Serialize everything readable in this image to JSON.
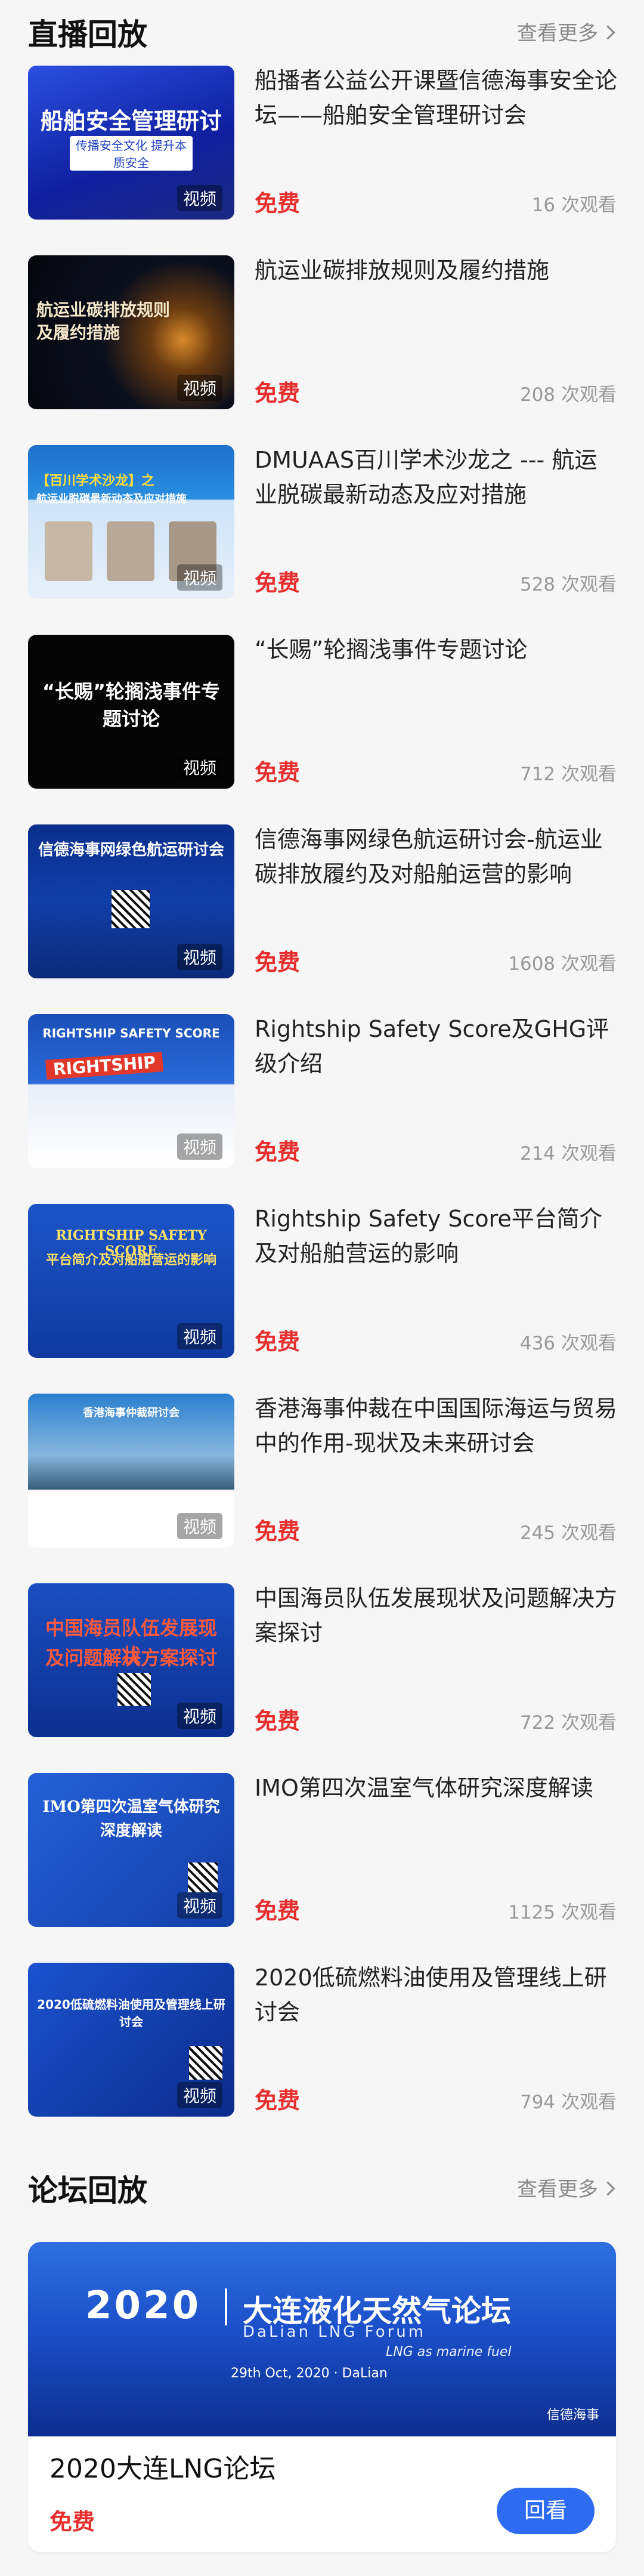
{
  "live_section": {
    "title": "直播回放",
    "more": "查看更多"
  },
  "items": [
    {
      "title": "船播者公益公开课暨信德海事安全论坛——船舶安全管理研讨会",
      "price": "免费",
      "views": "16 次观看",
      "tag": "视频",
      "thumb_lines": [
        "船舶安全管理研讨会",
        "传播安全文化 提升本质安全"
      ]
    },
    {
      "title": "航运业碳排放规则及履约措施",
      "price": "免费",
      "views": "208 次观看",
      "tag": "视频",
      "thumb_lines": [
        "航运业碳排放规则",
        "及履约措施"
      ]
    },
    {
      "title": "DMUAAS百川学术沙龙之 --- 航运业脱碳最新动态及应对措施",
      "price": "免费",
      "views": "528 次观看",
      "tag": "视频",
      "thumb_lines": [
        "【百川学术沙龙】之",
        "航运业脱碳最新动态及应对措施"
      ]
    },
    {
      "title": "“长赐”轮搁浅事件专题讨论",
      "price": "免费",
      "views": "712 次观看",
      "tag": "视频",
      "thumb_lines": [
        "“长赐”轮搁浅事件专题讨论"
      ]
    },
    {
      "title": "信德海事网绿色航运研讨会-航运业碳排放履约及对船舶运营的影响",
      "price": "免费",
      "views": "1608 次观看",
      "tag": "视频",
      "thumb_lines": [
        "信德海事网绿色航运研讨会"
      ]
    },
    {
      "title": "Rightship Safety Score及GHG评级介绍",
      "price": "免费",
      "views": "214 次观看",
      "tag": "视频",
      "thumb_lines": [
        "RIGHTSHIP SAFETY SCORE",
        "RIGHTSHIP"
      ]
    },
    {
      "title": "Rightship Safety Score平台简介及对船舶营运的影响",
      "price": "免费",
      "views": "436 次观看",
      "tag": "视频",
      "thumb_lines": [
        "RIGHTSHIP SAFETY SCORE",
        "平台简介及对船舶营运的影响"
      ]
    },
    {
      "title": "香港海事仲裁在中国国际海运与贸易中的作用-现状及未来研讨会",
      "price": "免费",
      "views": "245 次观看",
      "tag": "视频",
      "thumb_lines": [
        "香港海事仲裁研讨会"
      ]
    },
    {
      "title": "中国海员队伍发展现状及问题解决方案探讨",
      "price": "免费",
      "views": "722 次观看",
      "tag": "视频",
      "thumb_lines": [
        "中国海员队伍发展现状",
        "及问题解决方案探讨"
      ]
    },
    {
      "title": "IMO第四次温室气体研究深度解读",
      "price": "免费",
      "views": "1125 次观看",
      "tag": "视频",
      "thumb_lines": [
        "IMO第四次温室气体研究",
        "深度解读"
      ]
    },
    {
      "title": "2020低硫燃料油使用及管理线上研讨会",
      "price": "免费",
      "views": "794 次观看",
      "tag": "视频",
      "thumb_lines": [
        "2020低硫燃料油使用及管理线上研讨会"
      ]
    }
  ],
  "forum_section": {
    "title": "论坛回放",
    "more": "查看更多"
  },
  "forum": {
    "title": "2020大连LNG论坛",
    "price": "免费",
    "button": "回看",
    "banner_year": "2020",
    "banner_cn": "大连液化天然气论坛",
    "banner_en": "DaLian LNG Forum",
    "banner_sub": "LNG as marine fuel",
    "banner_date": "29th Oct, 2020 · DaLian",
    "banner_logo": "信德海事"
  },
  "colors": {
    "accent": "#2d6cf2",
    "price": "#e62e2e"
  }
}
